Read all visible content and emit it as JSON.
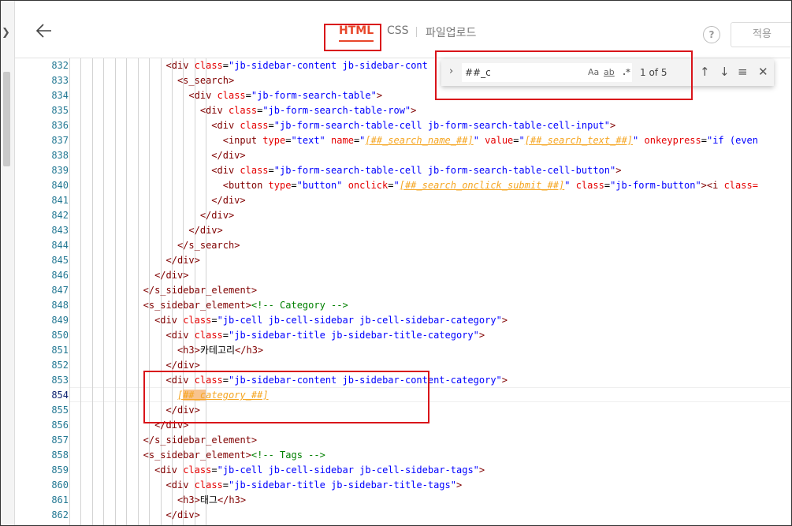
{
  "toolbar": {
    "tabs": [
      {
        "label": "HTML"
      },
      {
        "label": "CSS"
      },
      {
        "label": "파일업로드"
      }
    ],
    "help_label": "?",
    "apply_label": "적용"
  },
  "find": {
    "query": "##_c",
    "match_case_label": "Aa",
    "whole_word_label": "ab",
    "regex_label": ".*",
    "count": "1 of 5"
  },
  "editor": {
    "line_numbers": [
      "832",
      "833",
      "834",
      "835",
      "836",
      "837",
      "838",
      "839",
      "840",
      "841",
      "842",
      "843",
      "844",
      "845",
      "846",
      "847",
      "848",
      "849",
      "850",
      "851",
      "852",
      "853",
      "854",
      "855",
      "856",
      "857",
      "858",
      "859",
      "860",
      "861",
      "862"
    ],
    "lines": [
      {
        "indent": 8,
        "segs": [
          {
            "t": "<div ",
            "c": "t-tag"
          },
          {
            "t": "class",
            "c": "t-attr"
          },
          {
            "t": "=",
            "c": ""
          },
          {
            "t": "\"jb-sidebar-content jb-sidebar-cont",
            "c": "t-str"
          }
        ]
      },
      {
        "indent": 9,
        "segs": [
          {
            "t": "<s_search>",
            "c": "t-tag"
          }
        ]
      },
      {
        "indent": 10,
        "segs": [
          {
            "t": "<div ",
            "c": "t-tag"
          },
          {
            "t": "class",
            "c": "t-attr"
          },
          {
            "t": "=",
            "c": ""
          },
          {
            "t": "\"jb-form-search-table\"",
            "c": "t-str"
          },
          {
            "t": ">",
            "c": "t-tag"
          }
        ]
      },
      {
        "indent": 11,
        "segs": [
          {
            "t": "<div ",
            "c": "t-tag"
          },
          {
            "t": "class",
            "c": "t-attr"
          },
          {
            "t": "=",
            "c": ""
          },
          {
            "t": "\"jb-form-search-table-row\"",
            "c": "t-str"
          },
          {
            "t": ">",
            "c": "t-tag"
          }
        ]
      },
      {
        "indent": 12,
        "segs": [
          {
            "t": "<div ",
            "c": "t-tag"
          },
          {
            "t": "class",
            "c": "t-attr"
          },
          {
            "t": "=",
            "c": ""
          },
          {
            "t": "\"jb-form-search-table-cell jb-form-search-table-cell-input\"",
            "c": "t-str"
          },
          {
            "t": ">",
            "c": "t-tag"
          }
        ]
      },
      {
        "indent": 13,
        "segs": [
          {
            "t": "<input ",
            "c": "t-tag"
          },
          {
            "t": "type",
            "c": "t-attr"
          },
          {
            "t": "=",
            "c": ""
          },
          {
            "t": "\"text\"",
            "c": "t-str"
          },
          {
            "t": " ",
            "c": ""
          },
          {
            "t": "name",
            "c": "t-attr"
          },
          {
            "t": "=",
            "c": ""
          },
          {
            "t": "\"",
            "c": "t-str"
          },
          {
            "t": "[##_search_name_##]",
            "c": "t-ph"
          },
          {
            "t": "\"",
            "c": "t-str"
          },
          {
            "t": " ",
            "c": ""
          },
          {
            "t": "value",
            "c": "t-attr"
          },
          {
            "t": "=",
            "c": ""
          },
          {
            "t": "\"",
            "c": "t-str"
          },
          {
            "t": "[##_search_text_##]",
            "c": "t-ph"
          },
          {
            "t": "\"",
            "c": "t-str"
          },
          {
            "t": " ",
            "c": ""
          },
          {
            "t": "onkeypress",
            "c": "t-attr"
          },
          {
            "t": "=",
            "c": ""
          },
          {
            "t": "\"if (even",
            "c": "t-str"
          }
        ]
      },
      {
        "indent": 12,
        "segs": [
          {
            "t": "</div>",
            "c": "t-tag"
          }
        ]
      },
      {
        "indent": 12,
        "segs": [
          {
            "t": "<div ",
            "c": "t-tag"
          },
          {
            "t": "class",
            "c": "t-attr"
          },
          {
            "t": "=",
            "c": ""
          },
          {
            "t": "\"jb-form-search-table-cell jb-form-search-table-cell-button\"",
            "c": "t-str"
          },
          {
            "t": ">",
            "c": "t-tag"
          }
        ]
      },
      {
        "indent": 13,
        "segs": [
          {
            "t": "<button ",
            "c": "t-tag"
          },
          {
            "t": "type",
            "c": "t-attr"
          },
          {
            "t": "=",
            "c": ""
          },
          {
            "t": "\"button\"",
            "c": "t-str"
          },
          {
            "t": " ",
            "c": ""
          },
          {
            "t": "onclick",
            "c": "t-attr"
          },
          {
            "t": "=",
            "c": ""
          },
          {
            "t": "\"",
            "c": "t-str"
          },
          {
            "t": "[##_search_onclick_submit_##]",
            "c": "t-ph"
          },
          {
            "t": "\"",
            "c": "t-str"
          },
          {
            "t": " ",
            "c": ""
          },
          {
            "t": "class",
            "c": "t-attr"
          },
          {
            "t": "=",
            "c": ""
          },
          {
            "t": "\"jb-form-button\"",
            "c": "t-str"
          },
          {
            "t": "><i ",
            "c": "t-tag"
          },
          {
            "t": "class=",
            "c": "t-attr"
          }
        ]
      },
      {
        "indent": 12,
        "segs": [
          {
            "t": "</div>",
            "c": "t-tag"
          }
        ]
      },
      {
        "indent": 11,
        "segs": [
          {
            "t": "</div>",
            "c": "t-tag"
          }
        ]
      },
      {
        "indent": 10,
        "segs": [
          {
            "t": "</div>",
            "c": "t-tag"
          }
        ]
      },
      {
        "indent": 9,
        "segs": [
          {
            "t": "</s_search>",
            "c": "t-tag"
          }
        ]
      },
      {
        "indent": 8,
        "segs": [
          {
            "t": "</div>",
            "c": "t-tag"
          }
        ]
      },
      {
        "indent": 7,
        "segs": [
          {
            "t": "</div>",
            "c": "t-tag"
          }
        ]
      },
      {
        "indent": 6,
        "segs": [
          {
            "t": "</s_sidebar_element>",
            "c": "t-tag"
          }
        ]
      },
      {
        "indent": 6,
        "segs": [
          {
            "t": "<s_sidebar_element>",
            "c": "t-tag"
          },
          {
            "t": "<!-- Category -->",
            "c": "t-cmt"
          }
        ]
      },
      {
        "indent": 7,
        "segs": [
          {
            "t": "<div ",
            "c": "t-tag"
          },
          {
            "t": "class",
            "c": "t-attr"
          },
          {
            "t": "=",
            "c": ""
          },
          {
            "t": "\"jb-cell jb-cell-sidebar jb-cell-sidebar-category\"",
            "c": "t-str"
          },
          {
            "t": ">",
            "c": "t-tag"
          }
        ]
      },
      {
        "indent": 8,
        "segs": [
          {
            "t": "<div ",
            "c": "t-tag"
          },
          {
            "t": "class",
            "c": "t-attr"
          },
          {
            "t": "=",
            "c": ""
          },
          {
            "t": "\"jb-sidebar-title jb-sidebar-title-category\"",
            "c": "t-str"
          },
          {
            "t": ">",
            "c": "t-tag"
          }
        ]
      },
      {
        "indent": 9,
        "segs": [
          {
            "t": "<h3>",
            "c": "t-tag"
          },
          {
            "t": "카테고리",
            "c": ""
          },
          {
            "t": "</h3>",
            "c": "t-tag"
          }
        ]
      },
      {
        "indent": 8,
        "segs": [
          {
            "t": "</div>",
            "c": "t-tag"
          }
        ]
      },
      {
        "indent": 8,
        "segs": [
          {
            "t": "<div ",
            "c": "t-tag"
          },
          {
            "t": "class",
            "c": "t-attr"
          },
          {
            "t": "=",
            "c": ""
          },
          {
            "t": "\"jb-sidebar-content jb-sidebar-content-category\"",
            "c": "t-str"
          },
          {
            "t": ">",
            "c": "t-tag"
          }
        ]
      },
      {
        "indent": 9,
        "segs": [
          {
            "t": "[",
            "c": "t-ph"
          },
          {
            "t": "##_c",
            "c": "t-ph hl"
          },
          {
            "t": "ategory_##]",
            "c": "t-ph"
          }
        ]
      },
      {
        "indent": 8,
        "segs": [
          {
            "t": "</div>",
            "c": "t-tag"
          }
        ]
      },
      {
        "indent": 7,
        "segs": [
          {
            "t": "</div>",
            "c": "t-tag"
          }
        ]
      },
      {
        "indent": 6,
        "segs": [
          {
            "t": "</s_sidebar_element>",
            "c": "t-tag"
          }
        ]
      },
      {
        "indent": 6,
        "segs": [
          {
            "t": "<s_sidebar_element>",
            "c": "t-tag"
          },
          {
            "t": "<!-- Tags -->",
            "c": "t-cmt"
          }
        ]
      },
      {
        "indent": 7,
        "segs": [
          {
            "t": "<div ",
            "c": "t-tag"
          },
          {
            "t": "class",
            "c": "t-attr"
          },
          {
            "t": "=",
            "c": ""
          },
          {
            "t": "\"jb-cell jb-cell-sidebar jb-cell-sidebar-tags\"",
            "c": "t-str"
          },
          {
            "t": ">",
            "c": "t-tag"
          }
        ]
      },
      {
        "indent": 8,
        "segs": [
          {
            "t": "<div ",
            "c": "t-tag"
          },
          {
            "t": "class",
            "c": "t-attr"
          },
          {
            "t": "=",
            "c": ""
          },
          {
            "t": "\"jb-sidebar-title jb-sidebar-title-tags\"",
            "c": "t-str"
          },
          {
            "t": ">",
            "c": "t-tag"
          }
        ]
      },
      {
        "indent": 9,
        "segs": [
          {
            "t": "<h3>",
            "c": "t-tag"
          },
          {
            "t": "태그",
            "c": ""
          },
          {
            "t": "</h3>",
            "c": "t-tag"
          }
        ]
      },
      {
        "indent": 8,
        "segs": [
          {
            "t": "</div>",
            "c": "t-tag"
          }
        ]
      }
    ]
  },
  "colors": {
    "accent": "#e8472b",
    "annotation_red": "#d9141a",
    "line_number": "#237893"
  },
  "icons": [
    "back-arrow-icon",
    "chevron-right-icon",
    "help-icon",
    "arrow-up-icon",
    "arrow-down-icon",
    "find-in-selection-icon",
    "close-icon"
  ]
}
